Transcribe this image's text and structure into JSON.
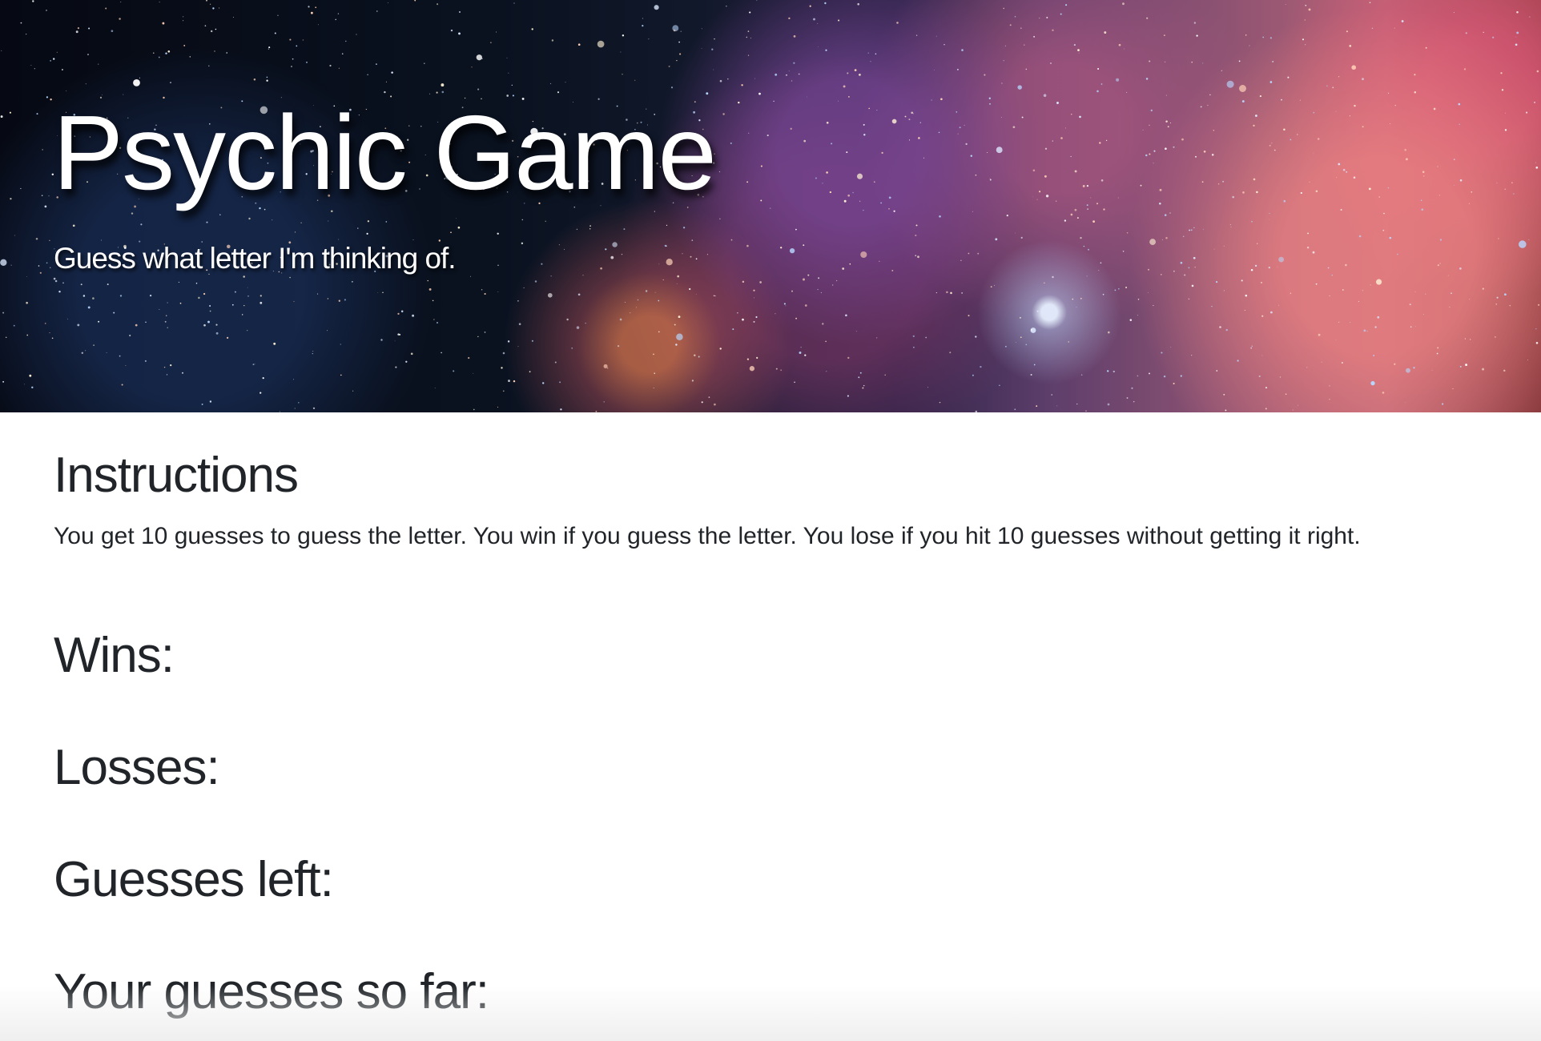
{
  "hero": {
    "title": "Psychic Game",
    "subtitle": "Guess what letter I'm thinking of."
  },
  "instructions": {
    "heading": "Instructions",
    "text": "You get 10 guesses to guess the letter. You win if you guess the letter. You lose if you hit 10 guesses without getting it right."
  },
  "stats": {
    "wins_label": "Wins:",
    "wins_value": "",
    "losses_label": "Losses:",
    "losses_value": "",
    "guesses_left_label": "Guesses left:",
    "guesses_left_value": "",
    "guesses_so_far_label": "Your guesses so far:",
    "guesses_so_far_value": ""
  },
  "colors": {
    "text": "#212529",
    "background": "#ffffff",
    "hero_text": "#ffffff"
  }
}
